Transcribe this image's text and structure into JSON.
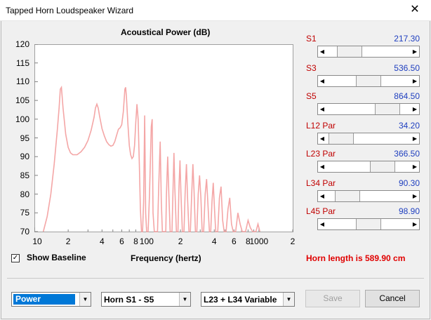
{
  "window": {
    "title": "Tapped Horn Loudspeaker Wizard",
    "close_glyph": "✕"
  },
  "chart_data": {
    "type": "line",
    "title": "Acoustical Power (dB)",
    "xlabel": "Frequency (hertz)",
    "ylabel": "",
    "x_scale": "log",
    "xlim": [
      10,
      2000
    ],
    "ylim": [
      70,
      120
    ],
    "x_tick_labels": [
      "10",
      "2",
      "4",
      "6",
      "8",
      "100",
      "2",
      "4",
      "6",
      "8",
      "1000",
      "2"
    ],
    "y_tick_labels": [
      "120",
      "115",
      "110",
      "105",
      "100",
      "95",
      "90",
      "85",
      "80",
      "75",
      "70"
    ],
    "series": [
      {
        "color": "#f4a6a6",
        "points": [
          [
            12,
            70
          ],
          [
            13,
            74
          ],
          [
            14,
            80
          ],
          [
            15,
            88
          ],
          [
            16,
            97
          ],
          [
            16.6,
            103
          ],
          [
            17,
            108
          ],
          [
            17.4,
            108.5
          ],
          [
            18,
            103
          ],
          [
            19,
            96
          ],
          [
            20,
            92.5
          ],
          [
            21,
            91
          ],
          [
            22,
            90.5
          ],
          [
            24,
            90.5
          ],
          [
            26,
            91.3
          ],
          [
            28,
            92.5
          ],
          [
            30,
            94.3
          ],
          [
            32,
            97
          ],
          [
            34,
            100.5
          ],
          [
            35,
            103
          ],
          [
            36,
            104
          ],
          [
            37,
            103
          ],
          [
            38,
            101
          ],
          [
            40,
            97.5
          ],
          [
            42,
            95.5
          ],
          [
            44,
            94
          ],
          [
            46,
            93.2
          ],
          [
            48,
            92.8
          ],
          [
            50,
            93
          ],
          [
            52,
            94
          ],
          [
            54,
            95.7
          ],
          [
            56,
            97.3
          ],
          [
            58,
            97.7
          ],
          [
            60,
            98.5
          ],
          [
            62,
            102
          ],
          [
            64,
            108
          ],
          [
            65,
            108.5
          ],
          [
            66,
            106
          ],
          [
            68,
            99
          ],
          [
            70,
            93
          ],
          [
            72,
            90.5
          ],
          [
            74,
            89.5
          ],
          [
            76,
            90
          ],
          [
            78,
            93
          ],
          [
            80,
            99
          ],
          [
            82,
            104
          ],
          [
            84,
            100
          ],
          [
            86,
            88
          ],
          [
            88,
            76
          ],
          [
            90,
            70
          ],
          [
            92,
            70
          ],
          [
            94,
            78
          ],
          [
            96,
            101
          ],
          [
            98,
            75
          ],
          [
            100,
            70
          ],
          [
            103,
            70
          ],
          [
            106,
            80
          ],
          [
            110,
            98
          ],
          [
            112,
            100
          ],
          [
            114,
            75
          ],
          [
            117,
            70
          ],
          [
            125,
            70
          ],
          [
            128,
            82
          ],
          [
            132,
            94
          ],
          [
            135,
            78
          ],
          [
            138,
            70
          ],
          [
            148,
            70
          ],
          [
            150,
            80
          ],
          [
            154,
            90
          ],
          [
            158,
            79
          ],
          [
            162,
            70
          ],
          [
            168,
            70
          ],
          [
            172,
            82
          ],
          [
            175,
            91
          ],
          [
            178,
            82
          ],
          [
            184,
            70
          ],
          [
            190,
            70
          ],
          [
            194,
            82
          ],
          [
            198,
            89
          ],
          [
            202,
            80
          ],
          [
            208,
            70
          ],
          [
            215,
            70
          ],
          [
            220,
            80
          ],
          [
            226,
            88
          ],
          [
            232,
            78
          ],
          [
            238,
            70
          ],
          [
            245,
            70
          ],
          [
            252,
            80
          ],
          [
            258,
            88
          ],
          [
            264,
            81
          ],
          [
            272,
            70
          ],
          [
            280,
            70
          ],
          [
            288,
            80
          ],
          [
            296,
            85
          ],
          [
            304,
            79
          ],
          [
            312,
            70
          ],
          [
            322,
            70
          ],
          [
            332,
            80
          ],
          [
            342,
            84
          ],
          [
            352,
            77
          ],
          [
            362,
            70
          ],
          [
            372,
            70
          ],
          [
            382,
            78
          ],
          [
            392,
            83
          ],
          [
            402,
            76
          ],
          [
            412,
            70
          ],
          [
            430,
            70
          ],
          [
            445,
            79
          ],
          [
            460,
            82
          ],
          [
            475,
            73
          ],
          [
            490,
            70
          ],
          [
            510,
            70
          ],
          [
            530,
            76
          ],
          [
            550,
            79
          ],
          [
            570,
            72
          ],
          [
            590,
            70
          ],
          [
            620,
            70
          ],
          [
            650,
            75
          ],
          [
            680,
            72
          ],
          [
            710,
            70
          ],
          [
            760,
            70
          ],
          [
            800,
            73
          ],
          [
            840,
            71
          ],
          [
            880,
            70
          ],
          [
            940,
            70
          ],
          [
            980,
            72
          ],
          [
            1020,
            70
          ]
        ]
      }
    ],
    "grid": false
  },
  "controls": {
    "show_baseline_label": "Show Baseline",
    "show_baseline_checked": true,
    "horn_length_text": "Horn length is 589.90 cm"
  },
  "params": [
    {
      "label": "S1",
      "value": "217.30",
      "fraction": 0.18
    },
    {
      "label": "S3",
      "value": "536.50",
      "fraction": 0.5
    },
    {
      "label": "S5",
      "value": "864.50",
      "fraction": 0.82
    },
    {
      "label": "L12  Par",
      "value": "34.20",
      "fraction": 0.03
    },
    {
      "label": "L23  Par",
      "value": "366.50",
      "fraction": 0.74
    },
    {
      "label": "L34  Par",
      "value": "90.30",
      "fraction": 0.14
    },
    {
      "label": "L45  Par",
      "value": "98.90",
      "fraction": 0.5
    }
  ],
  "bottom": {
    "mode_select": "Power",
    "horn_select": "Horn S1 - S5",
    "variable_select": "L23 + L34 Variable",
    "save_label": "Save",
    "cancel_label": "Cancel"
  }
}
